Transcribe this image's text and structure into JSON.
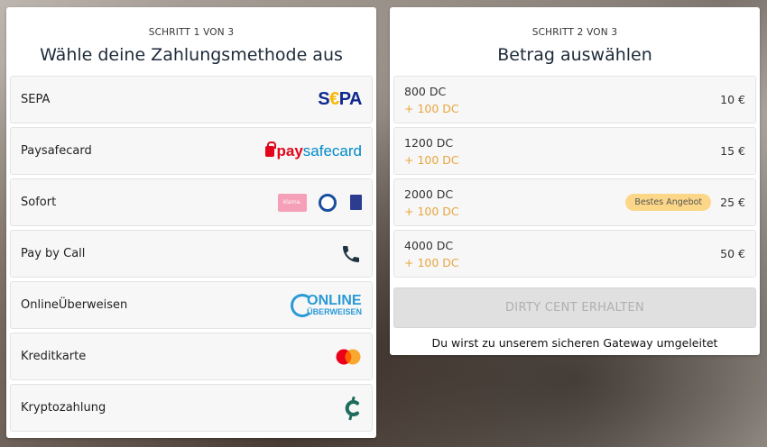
{
  "left": {
    "step_prefix": "SCHRITT",
    "step_num": "1",
    "step_mid": "VON",
    "step_total": "3",
    "title": "Wähle deine Zahlungsmethode aus",
    "methods": [
      {
        "label": "SEPA",
        "icon": "sepa-logo"
      },
      {
        "label": "Paysafecard",
        "icon": "paysafecard-logo"
      },
      {
        "label": "Sofort",
        "icon": "sofort-logos"
      },
      {
        "label": "Pay by Call",
        "icon": "phone-icon"
      },
      {
        "label": "OnlineÜberweisen",
        "icon": "onlineueberweisen-logo"
      },
      {
        "label": "Kreditkarte",
        "icon": "mastercard-logo"
      },
      {
        "label": "Kryptozahlung",
        "icon": "crypto-icon"
      }
    ],
    "logos": {
      "sepa_a": "S",
      "sepa_b": "€",
      "sepa_c": "PA",
      "psc_a": "pay",
      "psc_b": "safecard",
      "klarna": "klarna.",
      "online_1": "ONLINE",
      "online_2": "ÜBERWEISEN"
    }
  },
  "right": {
    "step_prefix": "SCHRITT",
    "step_num": "2",
    "step_mid": "VON",
    "step_total": "3",
    "title": "Betrag auswählen",
    "amounts": [
      {
        "amount": "800 DC",
        "bonus": "+ 100 DC",
        "price": "10 €",
        "badge": ""
      },
      {
        "amount": "1200 DC",
        "bonus": "+ 100 DC",
        "price": "15 €",
        "badge": ""
      },
      {
        "amount": "2000 DC",
        "bonus": "+ 100 DC",
        "price": "25 €",
        "badge": "Bestes Angebot"
      },
      {
        "amount": "4000 DC",
        "bonus": "+ 100 DC",
        "price": "50 €",
        "badge": ""
      }
    ],
    "cta_label": "DIRTY CENT ERHALTEN",
    "gateway_note": "Du wirst zu unserem sicheren Gateway umgeleitet"
  },
  "colors": {
    "accent_bonus": "#e8a640",
    "badge_bg": "#fcd788",
    "sepa_blue": "#10298e",
    "paysafecard_blue": "#008ac9",
    "crypto_teal": "#1f6d5e"
  }
}
